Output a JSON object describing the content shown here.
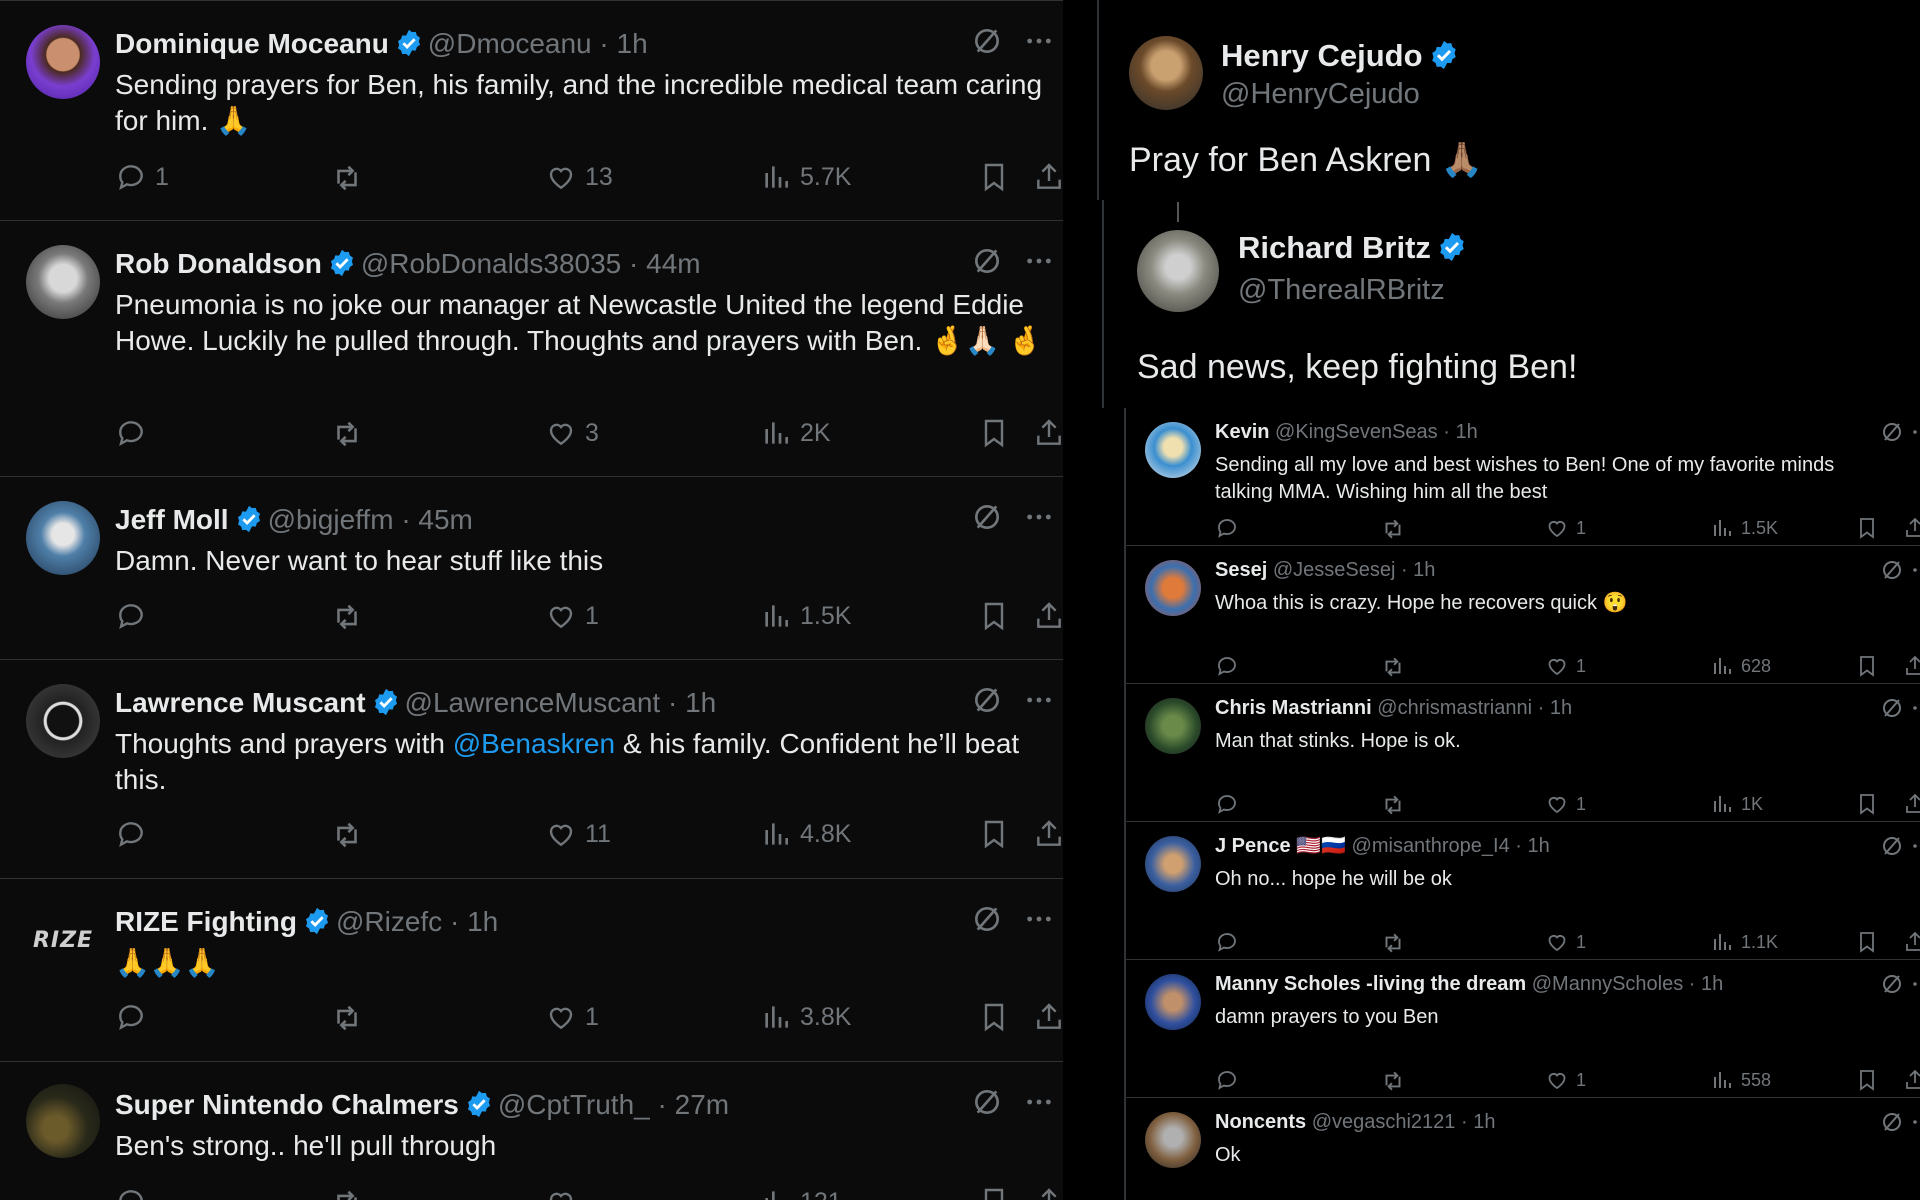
{
  "colors": {
    "accent": "#1d9bf0",
    "muted": "#71767b",
    "text": "#e7e9ea"
  },
  "left_feed": [
    {
      "name": "Dominique Moceanu",
      "handle": "@Dmoceanu",
      "time": "· 1h",
      "text": "Sending prayers for Ben, his family, and the incredible medical team caring for him. 🙏",
      "replies": "1",
      "reposts": "",
      "likes": "13",
      "views": "5.7K"
    },
    {
      "name": "Rob Donaldson",
      "handle": "@RobDonalds38035",
      "time": "· 44m",
      "text": "Pneumonia is no joke our manager at Newcastle United the legend Eddie Howe.  Luckily he pulled through.   Thoughts and prayers with Ben.   🤞🙏🏻 🤞",
      "replies": "",
      "reposts": "",
      "likes": "3",
      "views": "2K"
    },
    {
      "name": "Jeff Moll",
      "handle": "@bigjeffm",
      "time": "· 45m",
      "text": "Damn. Never want to hear stuff like this",
      "replies": "",
      "reposts": "",
      "likes": "1",
      "views": "1.5K"
    },
    {
      "name": "Lawrence Muscant",
      "handle": "@LawrenceMuscant",
      "time": "· 1h",
      "text_before": "Thoughts and prayers with ",
      "mention": "@Benaskren",
      "text_after": " & his family. Confident he’ll beat this.",
      "replies": "",
      "reposts": "",
      "likes": "11",
      "views": "4.8K"
    },
    {
      "name": "RIZE Fighting",
      "handle": "@Rizefc",
      "time": "· 1h",
      "text": "🙏🙏🙏",
      "avatar_text": "RIZE",
      "replies": "",
      "reposts": "",
      "likes": "1",
      "views": "3.8K"
    },
    {
      "name": "Super Nintendo Chalmers",
      "handle": "@CptTruth_",
      "time": "· 27m",
      "text": "Ben's strong.. he'll pull through",
      "replies": "",
      "reposts": "",
      "likes": "",
      "views": "121"
    }
  ],
  "right_feed": {
    "main1": {
      "name": "Henry Cejudo",
      "handle": "@HenryCejudo",
      "text": "Pray for Ben Askren 🙏🏽"
    },
    "main2": {
      "name": "Richard Britz",
      "handle": "@TherealRBritz",
      "text": "Sad news, keep fighting Ben!"
    },
    "replies": [
      {
        "name": "Kevin",
        "handle": "@KingSevenSeas",
        "time": "· 1h",
        "text": "Sending all my love and best wishes to Ben! One of my favorite minds talking MMA. Wishing him all the best",
        "likes": "1",
        "views": "1.5K"
      },
      {
        "name": "Sesej",
        "handle": "@JesseSesej",
        "time": "· 1h",
        "text": "Whoa this is crazy. Hope he recovers quick 😲",
        "likes": "1",
        "views": "628"
      },
      {
        "name": "Chris Mastrianni",
        "handle": "@chrismastrianni",
        "time": "· 1h",
        "text": "Man that stinks. Hope is ok.",
        "likes": "1",
        "views": "1K"
      },
      {
        "name": "J Pence 🇺🇸🇷🇺",
        "handle": "@misanthrope_I4",
        "time": "· 1h",
        "text": "Oh no... hope he will be ok",
        "likes": "1",
        "views": "1.1K"
      },
      {
        "name": "Manny Scholes -living the dream",
        "handle": "@MannyScholes",
        "time": "· 1h",
        "text": "damn prayers to you Ben",
        "likes": "1",
        "views": "558"
      },
      {
        "name": "Noncents",
        "handle": "@vegaschi2121",
        "time": "· 1h",
        "text": "Ok",
        "likes": "",
        "views": ""
      }
    ]
  }
}
